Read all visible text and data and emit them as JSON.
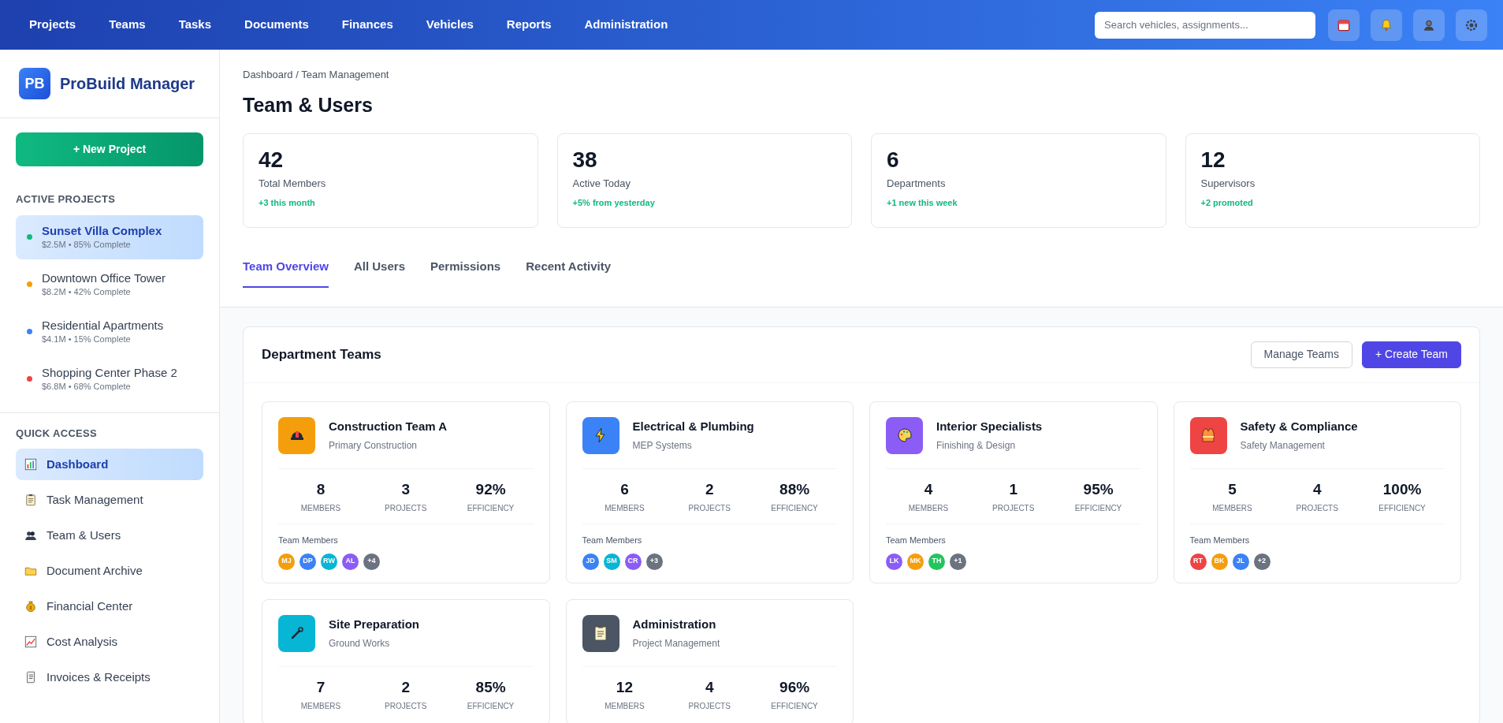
{
  "top_nav": {
    "items": [
      {
        "label": "Projects"
      },
      {
        "label": "Teams"
      },
      {
        "label": "Tasks"
      },
      {
        "label": "Documents"
      },
      {
        "label": "Finances"
      },
      {
        "label": "Vehicles"
      },
      {
        "label": "Reports"
      },
      {
        "label": "Administration"
      }
    ],
    "search": {
      "placeholder": "Search vehicles, assignments..."
    },
    "icons": [
      {
        "kind": "calendar"
      },
      {
        "kind": "bell"
      },
      {
        "kind": "user"
      },
      {
        "kind": "settings"
      }
    ]
  },
  "sidebar": {
    "logo": {
      "mark": "PB",
      "name": "ProBuild Manager"
    },
    "new_button": "+ New Project",
    "active_projects": {
      "heading": "ACTIVE PROJECTS",
      "items": [
        {
          "name": "Sunset Villa Complex",
          "meta": "$2.5M • 85% Complete",
          "color": "#10b981",
          "selected": true
        },
        {
          "name": "Downtown Office Tower",
          "meta": "$8.2M • 42% Complete",
          "color": "#f59e0b",
          "selected": false
        },
        {
          "name": "Residential Apartments",
          "meta": "$4.1M • 15% Complete",
          "color": "#3b82f6",
          "selected": false
        },
        {
          "name": "Shopping Center Phase 2",
          "meta": "$6.8M • 68% Complete",
          "color": "#ef4444",
          "selected": false
        }
      ]
    },
    "quick_access": {
      "heading": "QUICK ACCESS",
      "items": [
        {
          "label": "Dashboard",
          "kind": "chart",
          "selected": true
        },
        {
          "label": "Task Management",
          "kind": "clipboard",
          "selected": false
        },
        {
          "label": "Team & Users",
          "kind": "people",
          "selected": false
        },
        {
          "label": "Document Archive",
          "kind": "folder",
          "selected": false
        },
        {
          "label": "Financial Center",
          "kind": "moneybag",
          "selected": false
        },
        {
          "label": "Cost Analysis",
          "kind": "trend",
          "selected": false
        },
        {
          "label": "Invoices & Receipts",
          "kind": "scroll",
          "selected": false
        }
      ]
    }
  },
  "breadcrumb": "Dashboard / Team Management",
  "title": "Team & Users",
  "stats": [
    {
      "value": "42",
      "label": "Total Members",
      "change": "+3 this month"
    },
    {
      "value": "38",
      "label": "Active Today",
      "change": "+5% from yesterday"
    },
    {
      "value": "6",
      "label": "Departments",
      "change": "+1 new this week"
    },
    {
      "value": "12",
      "label": "Supervisors",
      "change": "+2 promoted"
    }
  ],
  "tabs": [
    {
      "label": "Team Overview",
      "selected": true
    },
    {
      "label": "All Users",
      "selected": false
    },
    {
      "label": "Permissions",
      "selected": false
    },
    {
      "label": "Recent Activity",
      "selected": false
    }
  ],
  "panel": {
    "title": "Department Teams",
    "buttons": [
      {
        "label": "Manage Teams",
        "kind": "secondary"
      },
      {
        "label": "+ Create Team",
        "kind": "primary"
      }
    ],
    "teams": [
      {
        "name": "Construction Team A",
        "subtitle": "Primary Construction",
        "kind": "hardhat",
        "color": "#f59e0b",
        "stats": [
          {
            "value": "8",
            "label": "MEMBERS"
          },
          {
            "value": "3",
            "label": "PROJECTS"
          },
          {
            "value": "92%",
            "label": "EFFICIENCY"
          }
        ],
        "members_label": "Team Members",
        "members": [
          {
            "initials": "MJ",
            "color": "#f59e0b"
          },
          {
            "initials": "DP",
            "color": "#3b82f6"
          },
          {
            "initials": "RW",
            "color": "#06b6d4"
          },
          {
            "initials": "AL",
            "color": "#8b5cf6"
          },
          {
            "initials": "+4",
            "color": "#6b7280"
          }
        ]
      },
      {
        "name": "Electrical & Plumbing",
        "subtitle": "MEP Systems",
        "kind": "bolt",
        "color": "#3b82f6",
        "stats": [
          {
            "value": "6",
            "label": "MEMBERS"
          },
          {
            "value": "2",
            "label": "PROJECTS"
          },
          {
            "value": "88%",
            "label": "EFFICIENCY"
          }
        ],
        "members_label": "Team Members",
        "members": [
          {
            "initials": "JD",
            "color": "#3b82f6"
          },
          {
            "initials": "SM",
            "color": "#06b6d4"
          },
          {
            "initials": "CR",
            "color": "#8b5cf6"
          },
          {
            "initials": "+3",
            "color": "#6b7280"
          }
        ]
      },
      {
        "name": "Interior Specialists",
        "subtitle": "Finishing & Design",
        "kind": "palette",
        "color": "#8b5cf6",
        "stats": [
          {
            "value": "4",
            "label": "MEMBERS"
          },
          {
            "value": "1",
            "label": "PROJECTS"
          },
          {
            "value": "95%",
            "label": "EFFICIENCY"
          }
        ],
        "members_label": "Team Members",
        "members": [
          {
            "initials": "LK",
            "color": "#8b5cf6"
          },
          {
            "initials": "MK",
            "color": "#f59e0b"
          },
          {
            "initials": "TH",
            "color": "#22c55e"
          },
          {
            "initials": "+1",
            "color": "#6b7280"
          }
        ]
      },
      {
        "name": "Safety & Compliance",
        "subtitle": "Safety Management",
        "kind": "vest",
        "color": "#ef4444",
        "stats": [
          {
            "value": "5",
            "label": "MEMBERS"
          },
          {
            "value": "4",
            "label": "PROJECTS"
          },
          {
            "value": "100%",
            "label": "EFFICIENCY"
          }
        ],
        "members_label": "Team Members",
        "members": [
          {
            "initials": "RT",
            "color": "#ef4444"
          },
          {
            "initials": "BK",
            "color": "#f59e0b"
          },
          {
            "initials": "JL",
            "color": "#3b82f6"
          },
          {
            "initials": "+2",
            "color": "#6b7280"
          }
        ]
      },
      {
        "name": "Site Preparation",
        "subtitle": "Ground Works",
        "kind": "wrench",
        "color": "#06b6d4",
        "stats": [
          {
            "value": "7",
            "label": "MEMBERS"
          },
          {
            "value": "2",
            "label": "PROJECTS"
          },
          {
            "value": "85%",
            "label": "EFFICIENCY"
          }
        ]
      },
      {
        "name": "Administration",
        "subtitle": "Project Management",
        "kind": "clipboard",
        "color": "#4b5563",
        "stats": [
          {
            "value": "12",
            "label": "MEMBERS"
          },
          {
            "value": "4",
            "label": "PROJECTS"
          },
          {
            "value": "96%",
            "label": "EFFICIENCY"
          }
        ]
      }
    ]
  }
}
